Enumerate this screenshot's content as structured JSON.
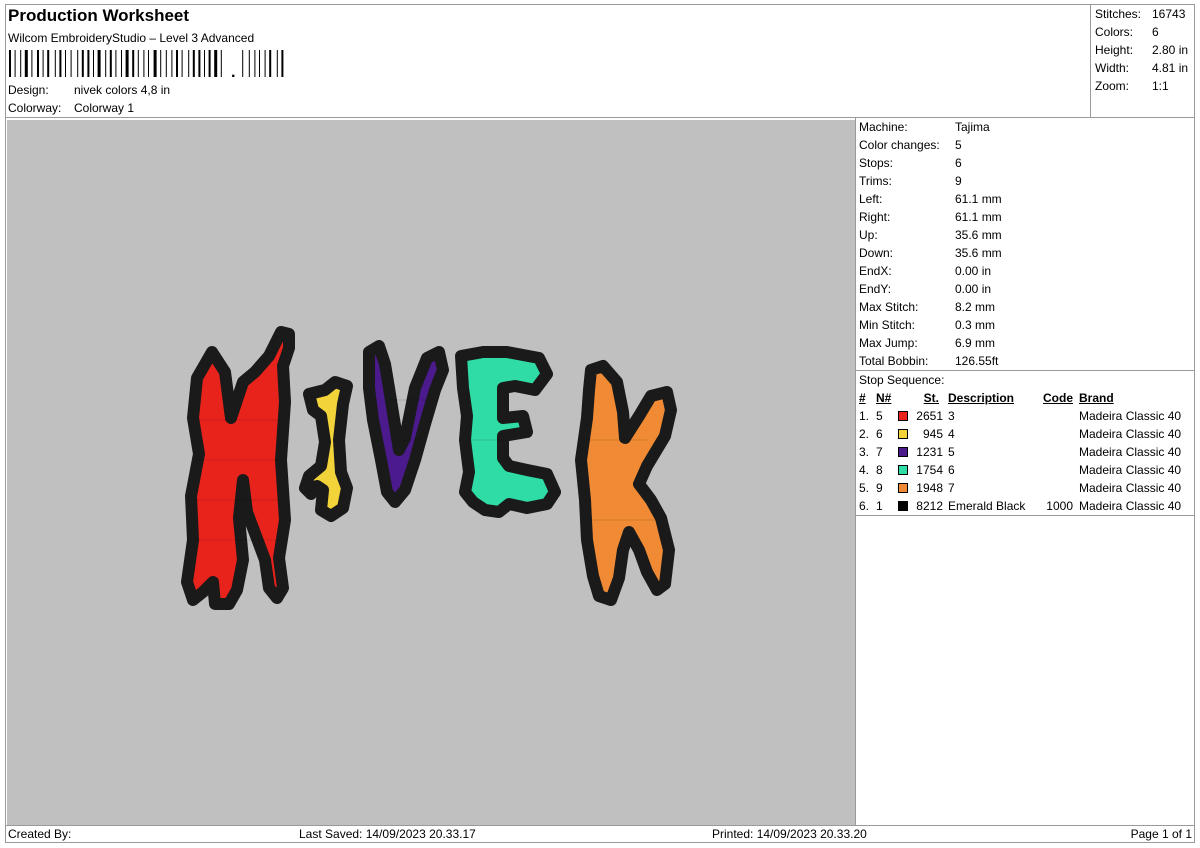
{
  "header": {
    "title": "Production Worksheet",
    "subtitle": "Wilcom EmbroideryStudio – Level 3 Advanced",
    "design_label": "Design:",
    "design_value": "nivek colors 4,8 in",
    "colorway_label": "Colorway:",
    "colorway_value": "Colorway 1"
  },
  "summary": [
    {
      "label": "Stitches:",
      "value": "16743"
    },
    {
      "label": "Colors:",
      "value": "6"
    },
    {
      "label": "Height:",
      "value": "2.80 in"
    },
    {
      "label": "Width:",
      "value": "4.81 in"
    },
    {
      "label": "Zoom:",
      "value": "1:1"
    }
  ],
  "design_preview": {
    "background": "#c0c0c0",
    "letters": [
      "N",
      "I",
      "V",
      "E",
      "K"
    ],
    "outline_color": "#1a1a1a"
  },
  "machine_info": [
    {
      "label": "Machine:",
      "value": "Tajima"
    },
    {
      "label": "Color changes:",
      "value": "5"
    },
    {
      "label": "Stops:",
      "value": "6"
    },
    {
      "label": "Trims:",
      "value": "9"
    },
    {
      "label": "Left:",
      "value": "61.1 mm"
    },
    {
      "label": "Right:",
      "value": "61.1 mm"
    },
    {
      "label": "Up:",
      "value": "35.6 mm"
    },
    {
      "label": "Down:",
      "value": "35.6 mm"
    },
    {
      "label": "EndX:",
      "value": "0.00 in"
    },
    {
      "label": "EndY:",
      "value": "0.00 in"
    },
    {
      "label": "Max Stitch:",
      "value": "8.2 mm"
    },
    {
      "label": "Min Stitch:",
      "value": "0.3 mm"
    },
    {
      "label": "Max Jump:",
      "value": "6.9 mm"
    },
    {
      "label": "Total Bobbin:",
      "value": "126.55ft"
    }
  ],
  "stop_sequence": {
    "label": "Stop Sequence:",
    "columns": {
      "idx": "#",
      "num": "N#",
      "st": "St.",
      "description": "Description",
      "code": "Code",
      "brand": "Brand"
    },
    "rows": [
      {
        "idx": "1.",
        "num": "5",
        "color": "#e8231c",
        "st": "2651",
        "description": "3",
        "code": "",
        "brand": "Madeira Classic 40"
      },
      {
        "idx": "2.",
        "num": "6",
        "color": "#f2d43a",
        "st": "945",
        "description": "4",
        "code": "",
        "brand": "Madeira Classic 40"
      },
      {
        "idx": "3.",
        "num": "7",
        "color": "#4b1a8c",
        "st": "1231",
        "description": "5",
        "code": "",
        "brand": "Madeira Classic 40"
      },
      {
        "idx": "4.",
        "num": "8",
        "color": "#2fdca5",
        "st": "1754",
        "description": "6",
        "code": "",
        "brand": "Madeira Classic 40"
      },
      {
        "idx": "5.",
        "num": "9",
        "color": "#f08a34",
        "st": "1948",
        "description": "7",
        "code": "",
        "brand": "Madeira Classic 40"
      },
      {
        "idx": "6.",
        "num": "1",
        "color": "#000000",
        "st": "8212",
        "description": "Emerald Black",
        "code": "1000",
        "brand": "Madeira Classic 40"
      }
    ]
  },
  "footer": {
    "created_by": "Created By:",
    "last_saved": "Last Saved: 14/09/2023 20.33.17",
    "printed": "Printed: 14/09/2023 20.33.20",
    "page": "Page 1 of 1"
  }
}
